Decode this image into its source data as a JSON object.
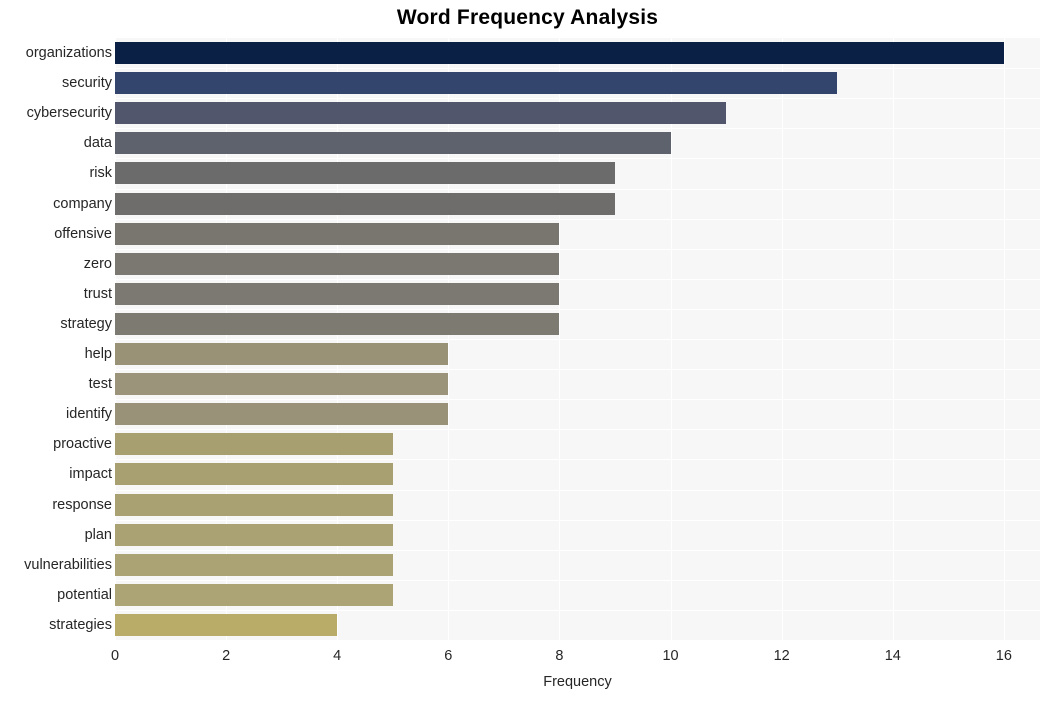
{
  "chart_data": {
    "type": "bar",
    "orientation": "horizontal",
    "title": "Word Frequency Analysis",
    "xlabel": "Frequency",
    "ylabel": "",
    "xlim": [
      0,
      16.65
    ],
    "xticks": [
      0,
      2,
      4,
      6,
      8,
      10,
      12,
      14,
      16
    ],
    "xtick_labels": [
      "0",
      "2",
      "4",
      "6",
      "8",
      "10",
      "12",
      "14",
      "16"
    ],
    "grid": true,
    "legend": null,
    "categories": [
      "organizations",
      "security",
      "cybersecurity",
      "data",
      "risk",
      "company",
      "offensive",
      "zero",
      "trust",
      "strategy",
      "help",
      "test",
      "identify",
      "proactive",
      "impact",
      "response",
      "plan",
      "vulnerabilities",
      "potential",
      "strategies"
    ],
    "values": [
      16,
      13,
      11,
      10,
      9,
      9,
      8,
      8,
      8,
      8,
      6,
      6,
      6,
      5,
      5,
      5,
      5,
      5,
      5,
      4
    ],
    "bar_colors": [
      "#0a2145",
      "#33446d",
      "#52566c",
      "#5e626d",
      "#6b6b6c",
      "#6e6d6c",
      "#78766f",
      "#7b7871",
      "#7c7972",
      "#7d7a72",
      "#9a9276",
      "#9c947a",
      "#9a9278",
      "#a89f71",
      "#a9a072",
      "#aaa173",
      "#aba274",
      "#aca374",
      "#ada475",
      "#b8ac68"
    ]
  },
  "style": {
    "plot_background": "#f7f7f7",
    "figure_background": "#ffffff",
    "gridline_color": "#ffffff",
    "text_color": "#262626",
    "title_color": "#000000"
  }
}
